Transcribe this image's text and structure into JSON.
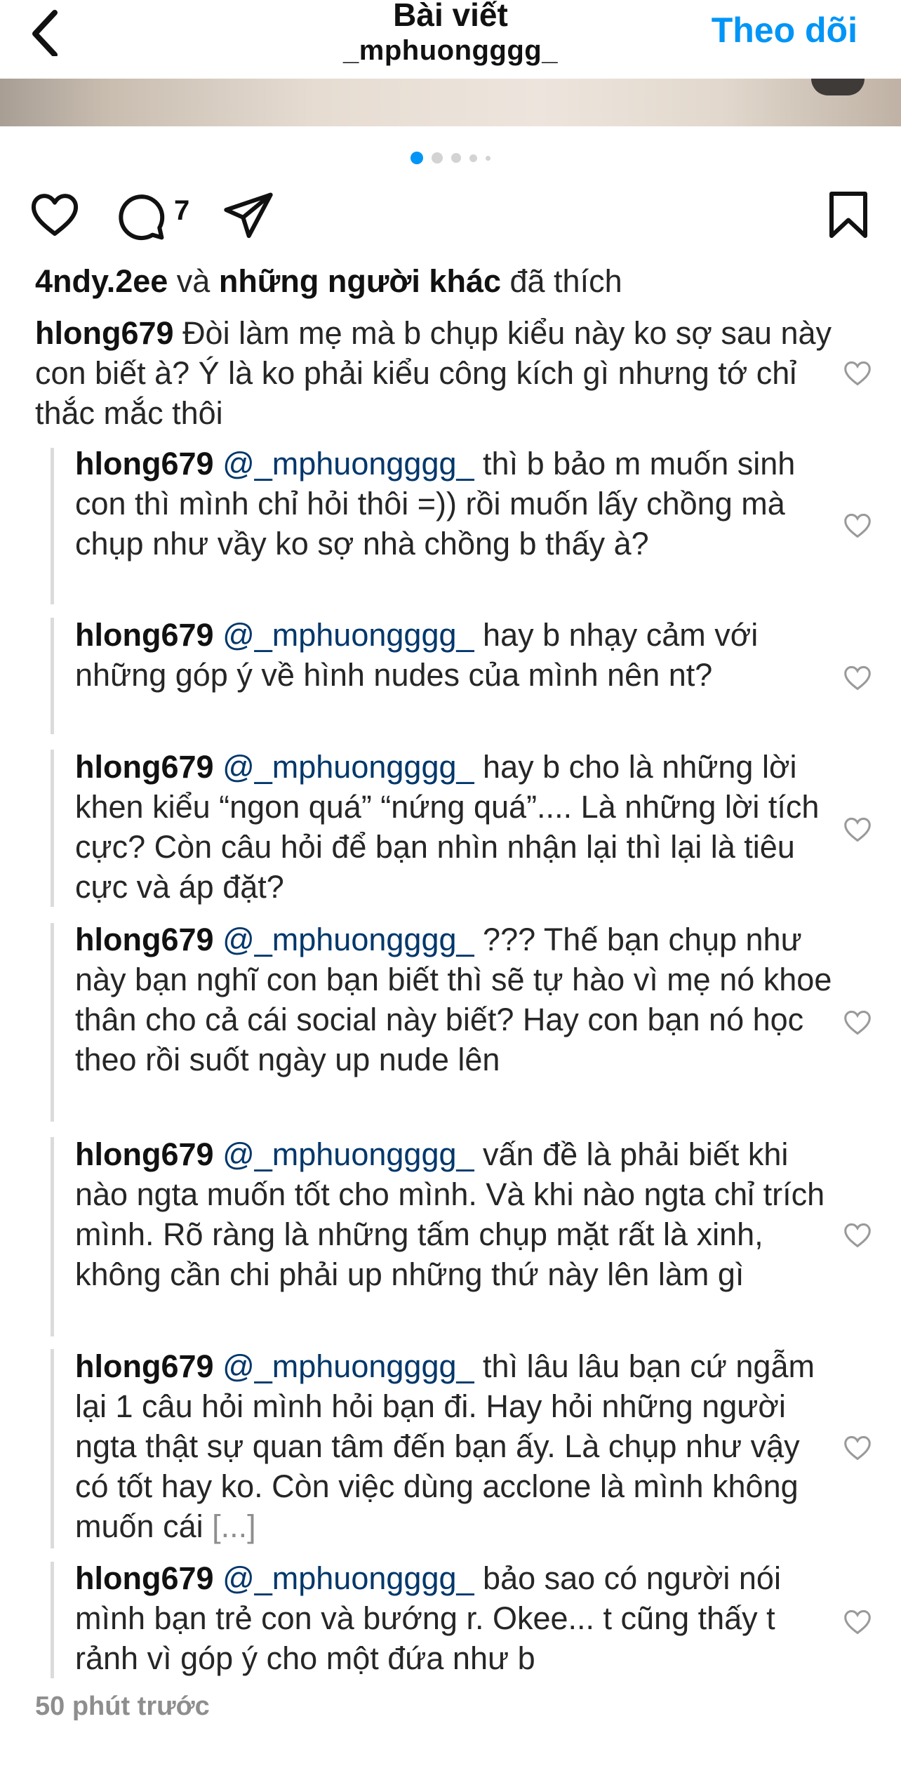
{
  "header": {
    "title": "Bài viết",
    "username": "_mphuongggg_",
    "follow_label": "Theo dõi"
  },
  "actions": {
    "comment_count": "7"
  },
  "likes": {
    "first": "4ndy.2ee",
    "joiner": " và ",
    "others": "những người khác",
    "suffix": " đã thích"
  },
  "caption": {
    "user": "hlong679",
    "text": "Đòi làm mẹ mà b chụp kiểu này ko sợ sau này con biết à? Ý là ko phải kiểu công kích gì nhưng tớ chỉ thắc mắc thôi"
  },
  "replies": [
    {
      "user": "hlong679",
      "mention": "@_mphuongggg_",
      "text": "thì b bảo m muốn sinh con thì mình chỉ hỏi thôi =)) rồi muốn lấy chồng mà chụp như vầy ko sợ nhà chồng b thấy à?"
    },
    {
      "user": "hlong679",
      "mention": "@_mphuongggg_",
      "text": "hay b nhạy cảm với những góp ý về hình nudes của mình nên nt?"
    },
    {
      "user": "hlong679",
      "mention": "@_mphuongggg_",
      "text": "hay b cho là những lời khen kiểu “ngon quá” “nứng quá”.... Là những lời tích cực? Còn câu hỏi để bạn nhìn nhận lại thì lại là tiêu cực và áp đặt?"
    },
    {
      "user": "hlong679",
      "mention": "@_mphuongggg_",
      "text": "??? Thế bạn chụp như này bạn nghĩ con bạn biết thì sẽ tự hào vì mẹ nó khoe thân cho cả cái social này biết? Hay con bạn nó học theo rồi suốt ngày up nude lên"
    },
    {
      "user": "hlong679",
      "mention": "@_mphuongggg_",
      "text": "vấn đề là phải biết khi nào ngta muốn tốt cho mình. Và khi nào ngta chỉ trích mình. Rõ ràng là những tấm chụp mặt rất là xinh, không cần chi phải up những thứ này lên làm gì"
    },
    {
      "user": "hlong679",
      "mention": "@_mphuongggg_",
      "text": "thì lâu lâu bạn cứ ngẫm lại 1 câu hỏi mình hỏi bạn đi. Hay hỏi những người ngta thật sự quan tâm đến bạn ấy. Là chụp như vậy có tốt hay ko. Còn việc dùng acclone là mình không muốn cái",
      "more": "[...]"
    },
    {
      "user": "hlong679",
      "mention": "@_mphuongggg_",
      "text": "bảo sao có người nói mình bạn trẻ con và bướng r. Okee... t cũng thấy t rảnh vì góp ý cho một đứa như b"
    }
  ],
  "timestamp": "50 phút trước",
  "colors": {
    "accent": "#0095f6",
    "mention": "#00376b",
    "muted": "#8e8e8e"
  }
}
